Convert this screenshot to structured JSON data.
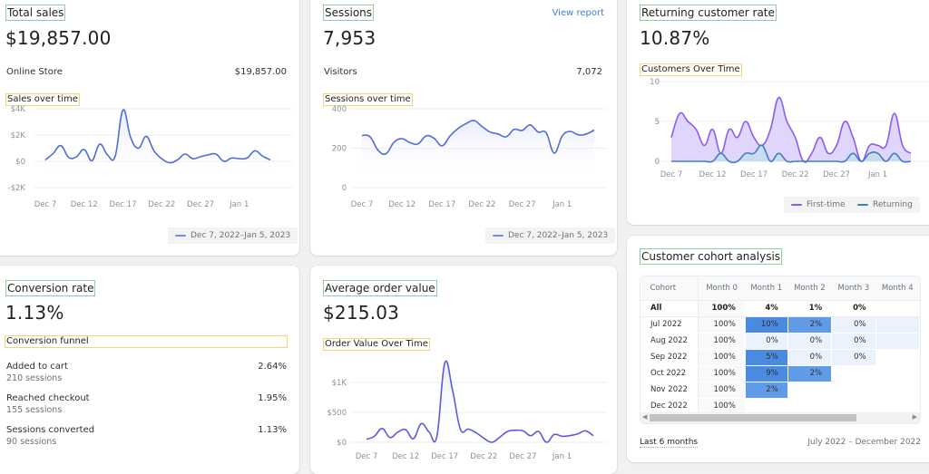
{
  "total_sales": {
    "title": "Total sales",
    "value": "$19,857.00",
    "breakdown_label": "Online Store",
    "breakdown_value": "$19,857.00",
    "chart_title": "Sales over time",
    "legend": "Dec 7, 2022–Jan 5, 2023"
  },
  "sessions": {
    "title": "Sessions",
    "value": "7,953",
    "view_report": "View report",
    "breakdown_label": "Visitors",
    "breakdown_value": "7,072",
    "chart_title": "Sessions over time",
    "legend": "Dec 7, 2022–Jan 5, 2023"
  },
  "returning": {
    "title": "Returning customer rate",
    "value": "10.87%",
    "chart_title": "Customers Over Time",
    "legend_first": "First-time",
    "legend_returning": "Returning"
  },
  "conversion": {
    "title": "Conversion rate",
    "value": "1.13%",
    "funnel_title": "Conversion funnel",
    "funnel": [
      {
        "label": "Added to cart",
        "sessions": "210 sessions",
        "rate": "2.64%"
      },
      {
        "label": "Reached checkout",
        "sessions": "155 sessions",
        "rate": "1.95%"
      },
      {
        "label": "Sessions converted",
        "sessions": "90 sessions",
        "rate": "1.13%"
      }
    ]
  },
  "aov": {
    "title": "Average order value",
    "value": "$215.03",
    "chart_title": "Order Value Over Time"
  },
  "cohort": {
    "title": "Customer cohort analysis",
    "headers": [
      "Cohort",
      "Month 0",
      "Month 1",
      "Month 2",
      "Month 3",
      "Month 4"
    ],
    "rows": [
      {
        "cohort": "All",
        "values": [
          "100%",
          "4%",
          "1%",
          "0%",
          ""
        ]
      },
      {
        "cohort": "Jul 2022",
        "values": [
          "100%",
          "10%",
          "2%",
          "0%",
          ""
        ]
      },
      {
        "cohort": "Aug 2022",
        "values": [
          "100%",
          "0%",
          "0%",
          "0%",
          ""
        ]
      },
      {
        "cohort": "Sep 2022",
        "values": [
          "100%",
          "5%",
          "0%",
          "0%",
          null
        ]
      },
      {
        "cohort": "Oct 2022",
        "values": [
          "100%",
          "9%",
          "2%",
          null,
          null
        ]
      },
      {
        "cohort": "Nov 2022",
        "values": [
          "100%",
          "2%",
          null,
          null,
          null
        ]
      },
      {
        "cohort": "Dec 2022",
        "values": [
          "100%",
          null,
          null,
          null,
          null
        ]
      }
    ],
    "footer_left": "Last 6 months",
    "footer_right": "July 2022 – December 2022",
    "colors": {
      "high": "#4a8be0",
      "mid": "#5f9be6",
      "low": "#ebf2fd"
    }
  },
  "chart_data": [
    {
      "type": "line",
      "title": "Sales over time",
      "x": [
        "Dec 7",
        "Dec 8",
        "Dec 9",
        "Dec 10",
        "Dec 11",
        "Dec 12",
        "Dec 13",
        "Dec 14",
        "Dec 15",
        "Dec 16",
        "Dec 17",
        "Dec 18",
        "Dec 19",
        "Dec 20",
        "Dec 21",
        "Dec 22",
        "Dec 23",
        "Dec 24",
        "Dec 25",
        "Dec 26",
        "Dec 27",
        "Dec 28",
        "Dec 29",
        "Dec 30",
        "Dec 31",
        "Jan 1",
        "Jan 2",
        "Jan 3",
        "Jan 4",
        "Jan 5"
      ],
      "xticks": [
        "Dec 7",
        "Dec 12",
        "Dec 17",
        "Dec 22",
        "Dec 27",
        "Jan 1"
      ],
      "yticks": [
        "$4K",
        "$2K",
        "$0",
        "-$2K"
      ],
      "ylim": [
        -2000,
        4000
      ],
      "series": [
        {
          "name": "Dec 7, 2022–Jan 5, 2023",
          "color": "#4f6fd6",
          "values": [
            100,
            600,
            1200,
            300,
            350,
            900,
            50,
            1300,
            500,
            400,
            3900,
            1800,
            1000,
            1900,
            800,
            200,
            -100,
            100,
            550,
            200,
            350,
            500,
            550,
            0,
            250,
            200,
            250,
            800,
            400,
            100
          ]
        }
      ]
    },
    {
      "type": "line",
      "title": "Sessions over time",
      "x": [
        "Dec 7",
        "Dec 8",
        "Dec 9",
        "Dec 10",
        "Dec 11",
        "Dec 12",
        "Dec 13",
        "Dec 14",
        "Dec 15",
        "Dec 16",
        "Dec 17",
        "Dec 18",
        "Dec 19",
        "Dec 20",
        "Dec 21",
        "Dec 22",
        "Dec 23",
        "Dec 24",
        "Dec 25",
        "Dec 26",
        "Dec 27",
        "Dec 28",
        "Dec 29",
        "Dec 30",
        "Dec 31",
        "Jan 1",
        "Jan 2",
        "Jan 3",
        "Jan 4",
        "Jan 5"
      ],
      "xticks": [
        "Dec 7",
        "Dec 12",
        "Dec 17",
        "Dec 22",
        "Dec 27",
        "Jan 1"
      ],
      "yticks": [
        "400",
        "200",
        "0"
      ],
      "ylim": [
        0,
        400
      ],
      "series": [
        {
          "name": "Dec 7, 2022–Jan 5, 2023",
          "color": "#4f6fd6",
          "values": [
            265,
            258,
            190,
            172,
            230,
            248,
            228,
            222,
            262,
            250,
            212,
            262,
            300,
            325,
            340,
            310,
            282,
            272,
            258,
            295,
            290,
            318,
            282,
            278,
            175,
            262,
            285,
            268,
            272,
            292
          ]
        }
      ]
    },
    {
      "type": "area",
      "title": "Customers Over Time",
      "x": [
        "Dec 7",
        "Dec 8",
        "Dec 9",
        "Dec 10",
        "Dec 11",
        "Dec 12",
        "Dec 13",
        "Dec 14",
        "Dec 15",
        "Dec 16",
        "Dec 17",
        "Dec 18",
        "Dec 19",
        "Dec 20",
        "Dec 21",
        "Dec 22",
        "Dec 23",
        "Dec 24",
        "Dec 25",
        "Dec 26",
        "Dec 27",
        "Dec 28",
        "Dec 29",
        "Dec 30",
        "Dec 31",
        "Jan 1",
        "Jan 2",
        "Jan 3",
        "Jan 4",
        "Jan 5"
      ],
      "xticks": [
        "Dec 7",
        "Dec 12",
        "Dec 17",
        "Dec 22",
        "Dec 27",
        "Jan 1"
      ],
      "yticks": [
        "10",
        "5",
        "0"
      ],
      "ylim": [
        0,
        10
      ],
      "legend": "bottom-right",
      "series": [
        {
          "name": "First-time",
          "color": "#8c5cf0",
          "fill": "#ddd0fb",
          "values": [
            3,
            6,
            5,
            4,
            2,
            4,
            1,
            4,
            3,
            5,
            3,
            2,
            4,
            8,
            5,
            3,
            0,
            1,
            3,
            1,
            2,
            5,
            3,
            0,
            2,
            2,
            2,
            6,
            2,
            1
          ]
        },
        {
          "name": "Returning",
          "color": "#3f7fc8",
          "fill": "#c7dcef",
          "values": [
            0,
            0,
            0,
            0,
            0,
            0,
            1,
            0,
            0,
            1,
            1,
            2,
            0,
            1,
            0,
            0,
            0,
            0,
            0,
            0,
            0,
            0,
            1,
            0,
            1,
            1,
            0,
            1,
            0,
            0
          ]
        }
      ]
    },
    {
      "type": "line",
      "title": "Order Value Over Time",
      "x": [
        "Dec 7",
        "Dec 8",
        "Dec 9",
        "Dec 10",
        "Dec 11",
        "Dec 12",
        "Dec 13",
        "Dec 14",
        "Dec 15",
        "Dec 16",
        "Dec 17",
        "Dec 18",
        "Dec 19",
        "Dec 20",
        "Dec 21",
        "Dec 22",
        "Dec 23",
        "Dec 24",
        "Dec 25",
        "Dec 26",
        "Dec 27",
        "Dec 28",
        "Dec 29",
        "Dec 30",
        "Dec 31",
        "Jan 1",
        "Jan 2",
        "Jan 3",
        "Jan 4",
        "Jan 5"
      ],
      "xticks": [
        "Dec 7",
        "Dec 12",
        "Dec 17",
        "Dec 22",
        "Dec 27",
        "Jan 1"
      ],
      "yticks": [
        "$1K",
        "$500",
        "$0"
      ],
      "ylim": [
        0,
        1300
      ],
      "series": [
        {
          "name": "Average order value",
          "color": "#5b5ae0",
          "values": [
            50,
            100,
            230,
            80,
            170,
            210,
            60,
            310,
            170,
            100,
            1320,
            870,
            220,
            220,
            160,
            70,
            0,
            80,
            180,
            200,
            190,
            110,
            180,
            0,
            130,
            100,
            110,
            140,
            190,
            110
          ]
        }
      ]
    }
  ]
}
